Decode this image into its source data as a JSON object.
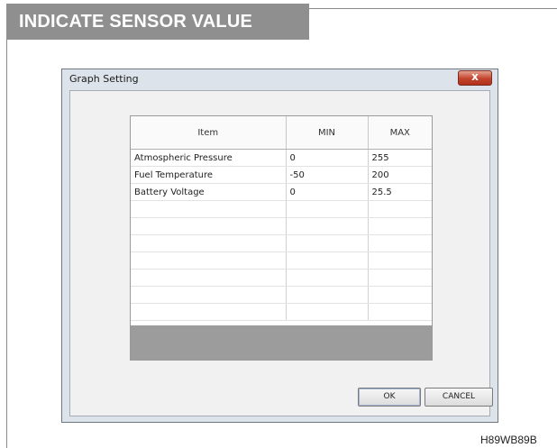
{
  "section_header": "INDICATE SENSOR VALUE",
  "figure_code": "H89WB89B",
  "dialog": {
    "title": "Graph Setting",
    "close_glyph": "x",
    "columns": [
      "Item",
      "MIN",
      "MAX"
    ],
    "rows": [
      [
        "Atmospheric Pressure",
        "0",
        "255"
      ],
      [
        "Fuel Temperature",
        "-50",
        "200"
      ],
      [
        "Battery Voltage",
        "0",
        "25.5"
      ]
    ],
    "empty_row_count": 7,
    "ok_label": "OK",
    "cancel_label": "CANCEL"
  },
  "colors": {
    "header_bg": "#8f8f8f",
    "dialog_bg": "#dde3ea",
    "close_button": "#c2432c",
    "grid_footer": "#9c9c9c"
  }
}
